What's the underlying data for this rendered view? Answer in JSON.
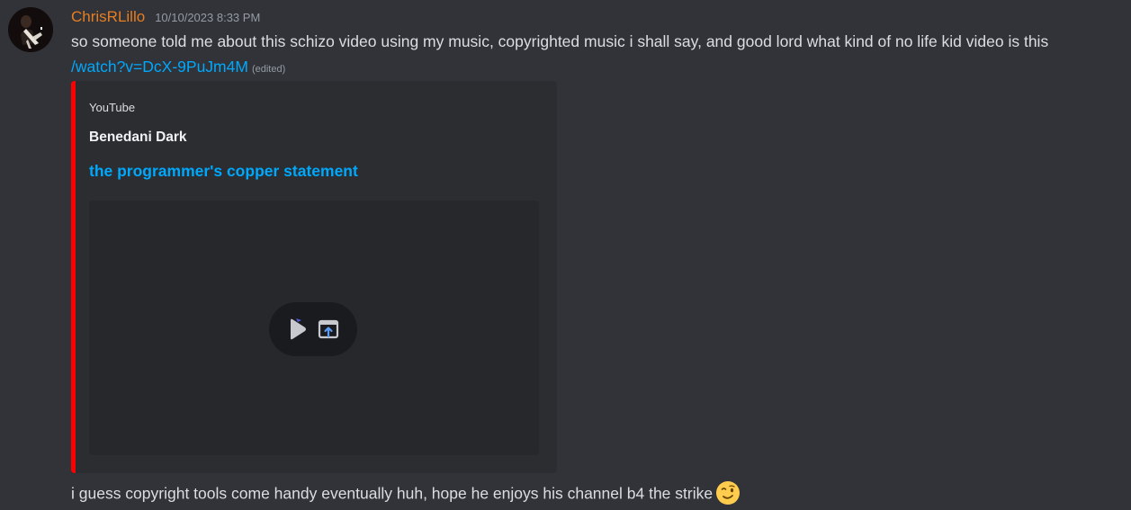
{
  "message": {
    "username": "ChrisRLillo",
    "timestamp": "10/10/2023 8:33 PM",
    "username_color": "#e67e22",
    "text_line1": "so someone told me about this schizo video using my music, copyrighted music i shall say, and good lord what kind of no life kid video is this",
    "link": "/watch?v=DcX-9PuJm4M",
    "link_color": "#00a8fc",
    "edited_label": "(edited)",
    "text_line3": "i guess copyright tools come handy eventually huh, hope he enjoys his channel b4 the strike",
    "emoji": "winking-face"
  },
  "embed": {
    "provider": "YouTube",
    "author": "Benedani Dark",
    "title": "the programmer's copper statement",
    "accent_color": "#ff0000",
    "controls": {
      "play_icon": "play-icon",
      "open_icon": "open-external-icon"
    }
  }
}
